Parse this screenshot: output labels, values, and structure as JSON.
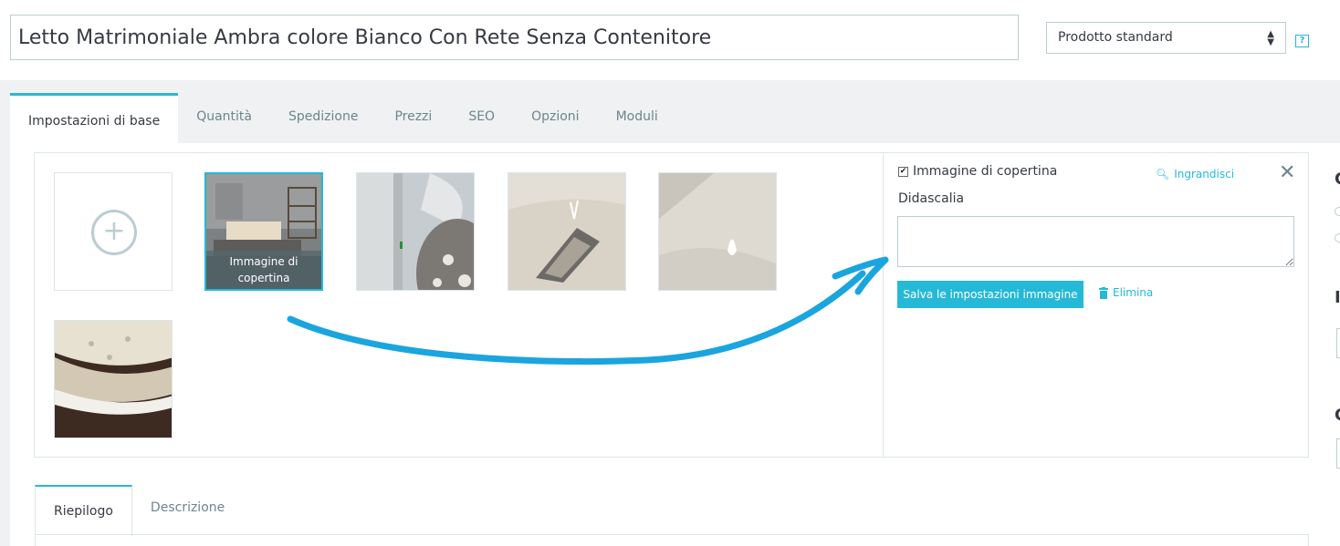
{
  "product": {
    "name": "Letto Matrimoniale Ambra colore Bianco Con Rete Senza Contenitore",
    "type_selected": "Prodotto standard",
    "help_label": "?"
  },
  "tabs": [
    {
      "label": "Impostazioni di base",
      "active": true
    },
    {
      "label": "Quantità"
    },
    {
      "label": "Spedizione"
    },
    {
      "label": "Prezzi"
    },
    {
      "label": "SEO"
    },
    {
      "label": "Opzioni"
    },
    {
      "label": "Moduli"
    }
  ],
  "images": {
    "add_symbol": "+",
    "cover_label": "Immagine di copertina",
    "thumbnails": [
      {
        "icon": "bed-photo"
      },
      {
        "icon": "fabric-detail-photo"
      },
      {
        "icon": "mattress-tuft-photo"
      },
      {
        "icon": "mattress-surface-photo"
      },
      {
        "icon": "mattress-stack-photo"
      }
    ]
  },
  "image_settings": {
    "cover_checkbox_label": "Immagine di copertina",
    "cover_checked": true,
    "zoom_label": "Ingrandisci",
    "caption_label": "Didascalia",
    "caption_value": "",
    "save_label": "Salva le impostazioni immagine",
    "delete_label": "Elimina"
  },
  "subtabs": [
    {
      "label": "Riepilogo",
      "active": true
    },
    {
      "label": "Descrizione"
    }
  ],
  "colors": {
    "accent": "#25b9d7",
    "border": "#bbcdd2",
    "background": "#eff1f2",
    "annotation_arrow": "#1aa5df"
  }
}
